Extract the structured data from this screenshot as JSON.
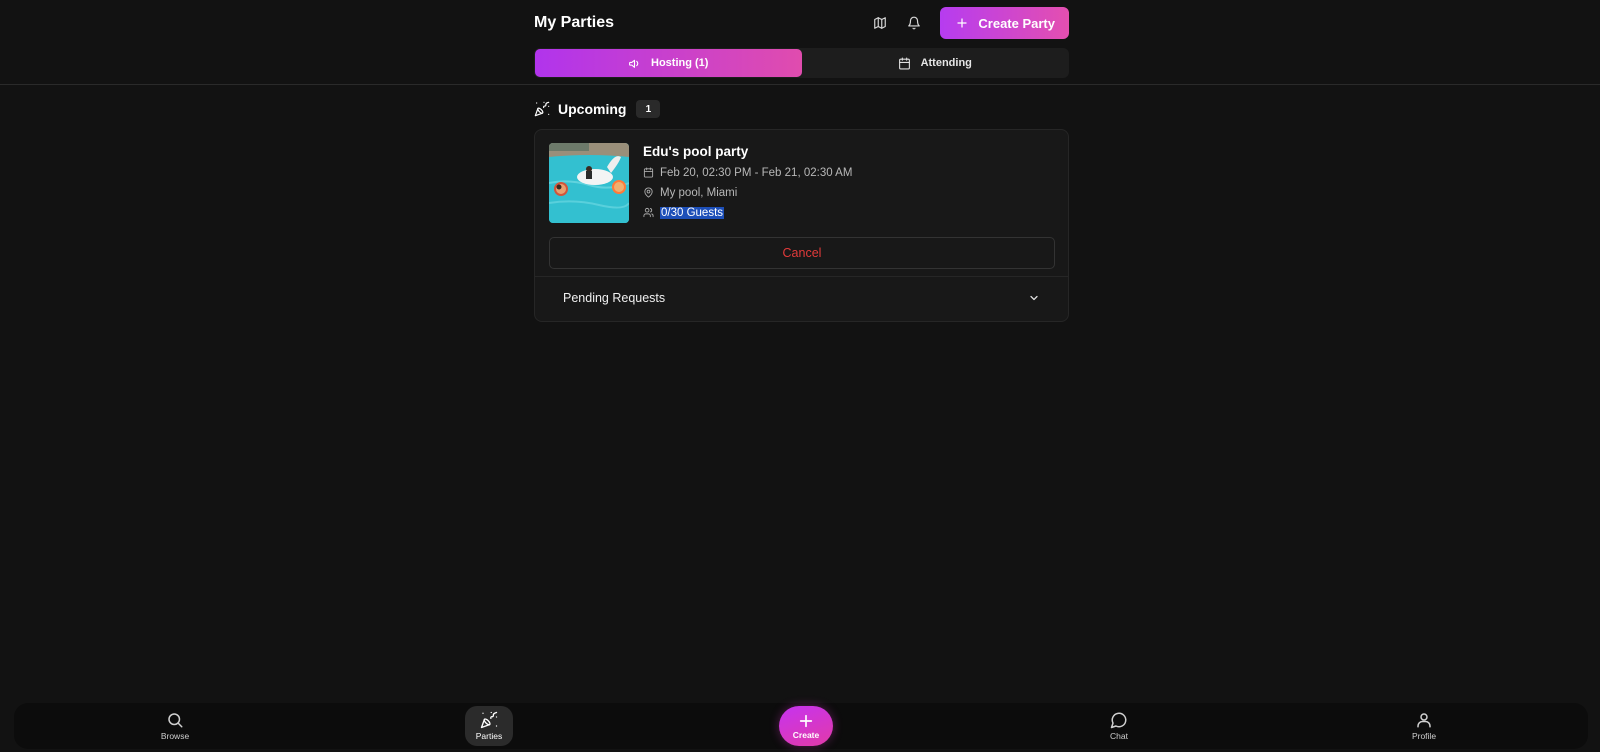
{
  "header": {
    "title": "My Parties",
    "map_icon": "map-icon",
    "bell_icon": "bell-icon",
    "create_button_label": "Create Party"
  },
  "tabs": [
    {
      "label": "Hosting (1)",
      "icon": "megaphone-icon",
      "active": true
    },
    {
      "label": "Attending",
      "icon": "calendar-icon",
      "active": false
    }
  ],
  "section": {
    "icon": "party-popper-icon",
    "title": "Upcoming",
    "count": "1"
  },
  "party": {
    "name": "Edu's pool party",
    "datetime": "Feb 20, 02:30 PM - Feb 21, 02:30 AM",
    "location": "My pool, Miami",
    "guests": "0/30 Guests",
    "cancel_label": "Cancel",
    "pending_label": "Pending Requests"
  },
  "bottom_nav": [
    {
      "label": "Browse",
      "icon": "search-icon",
      "active": false
    },
    {
      "label": "Parties",
      "icon": "party-popper-icon",
      "active": true
    },
    {
      "label": "Create",
      "icon": "plus-icon",
      "active": false
    },
    {
      "label": "Chat",
      "icon": "chat-bubble-icon",
      "active": false
    },
    {
      "label": "Profile",
      "icon": "user-icon",
      "active": false
    }
  ],
  "colors": {
    "background": "#121212",
    "accent_start": "#b63cf0",
    "accent_end": "#e44fb0",
    "danger": "#e23a3a",
    "selection": "#1d4fb8"
  }
}
